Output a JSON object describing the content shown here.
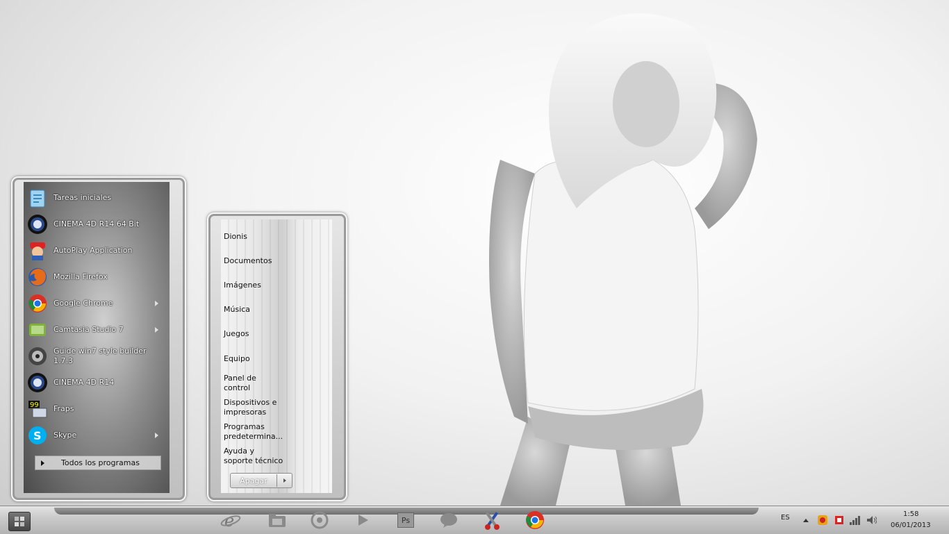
{
  "start_menu": {
    "programs": [
      {
        "label": "Tareas iniciales",
        "icon": "getting-started-icon",
        "has_submenu": false
      },
      {
        "label": "CINEMA 4D R14 64 Bit",
        "icon": "cinema4d-icon",
        "has_submenu": false
      },
      {
        "label": "AutoPlay Application",
        "icon": "mario-icon",
        "has_submenu": false
      },
      {
        "label": "Mozilla Firefox",
        "icon": "firefox-icon",
        "has_submenu": false
      },
      {
        "label": "Google Chrome",
        "icon": "chrome-icon",
        "has_submenu": true
      },
      {
        "label": "Camtasia Studio 7",
        "icon": "camtasia-icon",
        "has_submenu": true
      },
      {
        "label": "Guide win7 style builder 1.7.3",
        "icon": "style-builder-icon",
        "has_submenu": false
      },
      {
        "label": "CINEMA 4D R14",
        "icon": "cinema4d-icon",
        "has_submenu": false
      },
      {
        "label": "Fraps",
        "icon": "fraps-icon",
        "has_submenu": false
      },
      {
        "label": "Skype",
        "icon": "skype-icon",
        "has_submenu": true
      }
    ],
    "all_programs": "Todos los programas",
    "places": [
      "Dionis",
      "Documentos",
      "Imágenes",
      "Música",
      "Juegos",
      "Equipo",
      "Panel de\ncontrol",
      "Dispositivos e\nimpresoras",
      "Programas\npredetermina...",
      "Ayuda y\nsoporte técnico"
    ],
    "shutdown_label": "Apagar"
  },
  "taskbar": {
    "pinned": [
      "internet-explorer-icon",
      "file-explorer-icon",
      "media-center-icon",
      "media-player-icon",
      "photoshop-icon",
      "chat-bubble-icon",
      "tools-icon",
      "chrome-icon"
    ],
    "photoshop_label": "Ps",
    "language": "ES",
    "time": "1:58",
    "date": "06/01/2013"
  },
  "colors": {
    "taskbar": "#c4c4c4",
    "menu_frame": "#d0d0d0"
  }
}
